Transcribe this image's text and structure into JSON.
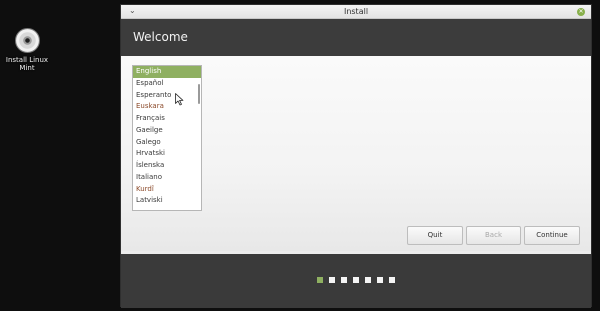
{
  "desktop": {
    "icon_name": "disc-icon",
    "label_line1": "Install Linux",
    "label_line2": "Mint"
  },
  "window": {
    "title": "Install",
    "accent": "#8fb061",
    "header_title": "Welcome",
    "languages": [
      "English",
      "Español",
      "Esperanto",
      "Euskara",
      "Français",
      "Gaeilge",
      "Galego",
      "Hrvatski",
      "Íslenska",
      "Italiano",
      "Kurdî",
      "Latviski"
    ],
    "selected_language": "English",
    "buttons": {
      "quit": "Quit",
      "back": "Back",
      "continue": "Continue"
    },
    "progress": {
      "total_steps": 7,
      "current_step": 1
    }
  }
}
